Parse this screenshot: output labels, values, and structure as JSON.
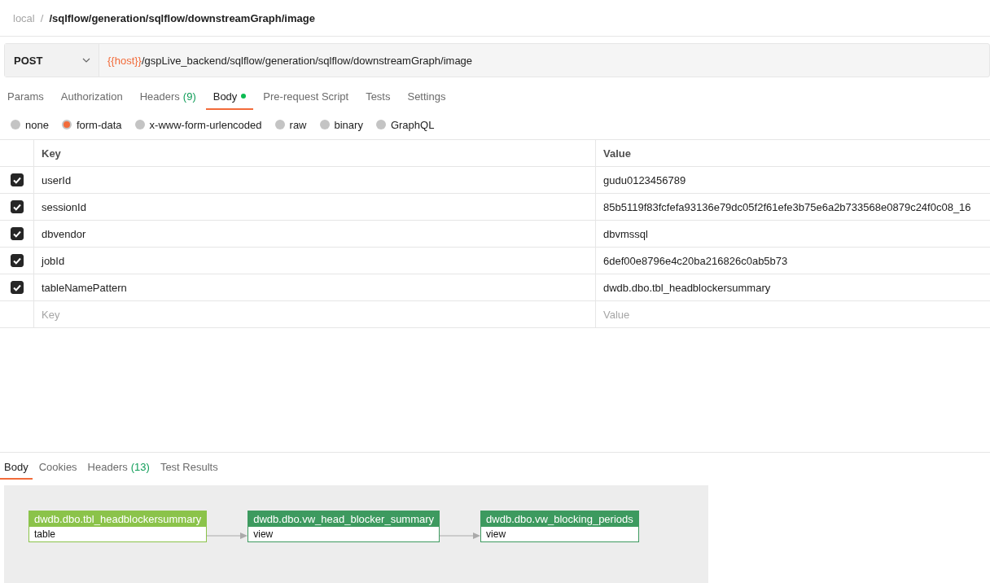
{
  "breadcrumb": {
    "parent": "local",
    "separator": "/",
    "title": "/sqlflow/generation/sqlflow/downstreamGraph/image"
  },
  "request": {
    "method": "POST",
    "url_variable": "{{host}}",
    "url_path": "/gspLive_backend/sqlflow/generation/sqlflow/downstreamGraph/image"
  },
  "request_tabs": [
    {
      "label": "Params",
      "selected": false,
      "modified": false
    },
    {
      "label": "Authorization",
      "selected": false,
      "modified": false
    },
    {
      "label": "Headers",
      "count": "(9)",
      "selected": false,
      "modified": false
    },
    {
      "label": "Body",
      "selected": true,
      "modified": true
    },
    {
      "label": "Pre-request Script",
      "selected": false,
      "modified": false
    },
    {
      "label": "Tests",
      "selected": false,
      "modified": false
    },
    {
      "label": "Settings",
      "selected": false,
      "modified": false
    }
  ],
  "body_types": [
    {
      "label": "none",
      "selected": false
    },
    {
      "label": "form-data",
      "selected": true
    },
    {
      "label": "x-www-form-urlencoded",
      "selected": false
    },
    {
      "label": "raw",
      "selected": false
    },
    {
      "label": "binary",
      "selected": false
    },
    {
      "label": "GraphQL",
      "selected": false
    }
  ],
  "table": {
    "columns": [
      "Key",
      "Value"
    ],
    "rows": [
      {
        "key": "userId",
        "value": "gudu0123456789",
        "checked": true
      },
      {
        "key": "sessionId",
        "value": "85b5119f83fcfefa93136e79dc05f2f61efe3b75e6a2b733568e0879c24f0c08_16",
        "checked": true
      },
      {
        "key": "dbvendor",
        "value": "dbvmssql",
        "checked": true
      },
      {
        "key": "jobId",
        "value": "6def00e8796e4c20ba216826c0ab5b73",
        "checked": true
      },
      {
        "key": "tableNamePattern",
        "value": "dwdb.dbo.tbl_headblockersummary",
        "checked": true
      }
    ],
    "placeholder_key": "Key",
    "placeholder_value": "Value"
  },
  "response_tabs": [
    {
      "label": "Body",
      "selected": true
    },
    {
      "label": "Cookies",
      "selected": false
    },
    {
      "label": "Headers",
      "count": "(13)",
      "selected": false
    },
    {
      "label": "Test Results",
      "selected": false
    }
  ],
  "graph": {
    "nodes": [
      {
        "name": "dwdb.dbo.tbl_headblockersummary",
        "type": "table",
        "color": "#8bc34a"
      },
      {
        "name": "dwdb.dbo.vw_head_blocker_summary",
        "type": "view",
        "color": "#3d9a5f"
      },
      {
        "name": "dwdb.dbo.vw_blocking_periods",
        "type": "view",
        "color": "#3d9a5f"
      }
    ]
  }
}
